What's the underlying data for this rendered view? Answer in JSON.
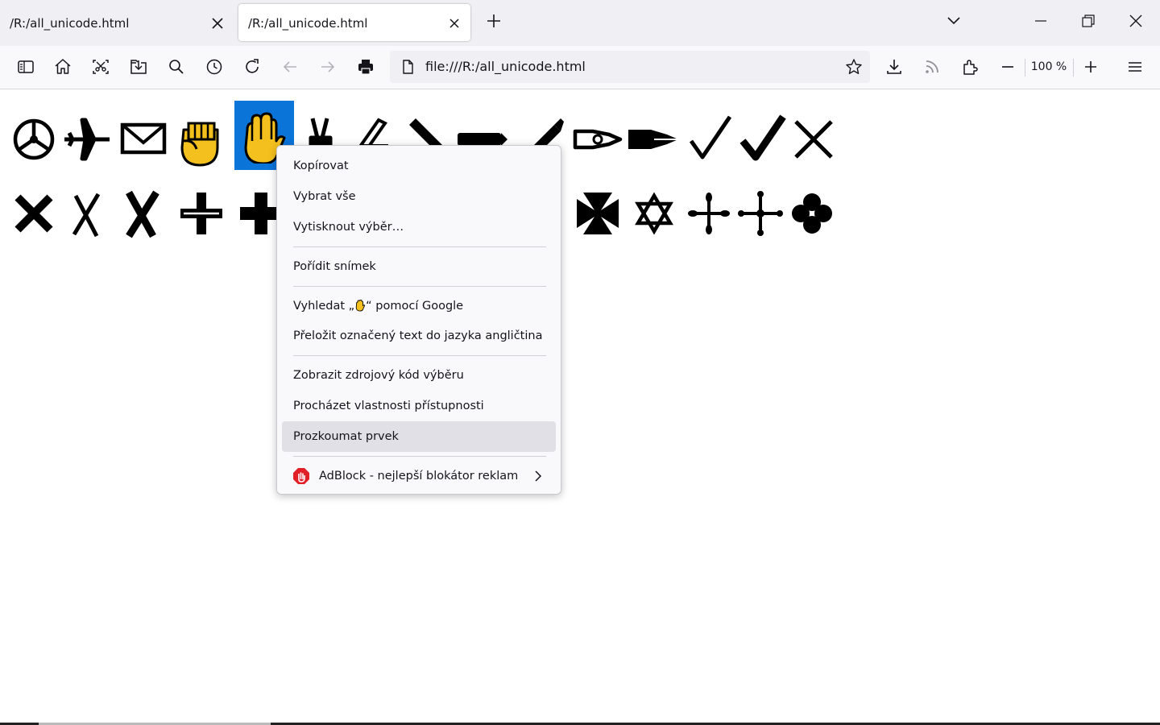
{
  "tabs": [
    {
      "title": "/R:/all_unicode.html",
      "active": false
    },
    {
      "title": "/R:/all_unicode.html",
      "active": true
    }
  ],
  "tabstrip": {
    "new_tab_icon": "plus-icon",
    "list_all_tabs_icon": "chevron-down-icon"
  },
  "window_controls": {
    "minimize_icon": "minimize-icon",
    "restore_icon": "restore-icon",
    "close_icon": "close-icon"
  },
  "toolbar": {
    "url": "file:///R:/all_unicode.html",
    "zoom_level": "100 %",
    "icons": [
      "sidebar-icon",
      "home-icon",
      "screenshot-icon",
      "save-page-icon",
      "search-icon",
      "history-icon",
      "reload-icon",
      "back-icon",
      "forward-icon",
      "print-icon",
      "bookmark-star-icon",
      "downloads-icon",
      "rss-icon",
      "extensions-icon",
      "zoom-out-icon",
      "zoom-in-icon",
      "menu-icon"
    ]
  },
  "page": {
    "row1_glyphs": [
      "steering-wheel",
      "airplane",
      "envelope",
      "raised-fist",
      "raised-hand",
      "victory-hand",
      "writing-hand",
      "pencil-lower-right",
      "pencil",
      "pencil-upper-right",
      "white-nib",
      "nib",
      "check-mark",
      "heavy-check-mark",
      "multiplication-x"
    ],
    "row2_glyphs": [
      "heavy-multiplication-x",
      "ballot-x",
      "heavy-ballot-x",
      "outlined-greek-cross",
      "heavy-greek-cross",
      "maltese-cross",
      "star-of-david",
      "six-teardrop-asterisk",
      "four-ball-asterisk",
      "four-club-asterisk"
    ],
    "selected_glyph": "raised-hand"
  },
  "context_menu": {
    "items": [
      {
        "label": "Kopírovat"
      },
      {
        "label": "Vybrat vše"
      },
      {
        "label": "Vytisknout výběr…"
      },
      {
        "label": "Pořídit snímek"
      },
      {
        "label_before": "Vyhledat „",
        "label_after": "“ pomocí Google"
      },
      {
        "label": "Přeložit označený text do jazyka angličtina"
      },
      {
        "label": "Zobrazit zdrojový kód výběru"
      },
      {
        "label": "Procházet vlastnosti přístupnosti"
      },
      {
        "label": "Prozkoumat prvek",
        "highlighted": true
      },
      {
        "label": "AdBlock - nejlepší blokátor reklam",
        "has_submenu": true
      }
    ]
  },
  "colors": {
    "selection": "#0a74d9",
    "emoji_yellow": "#f4c01e",
    "adblock_red": "#e01f26",
    "menu_hover": "#e0e0e6"
  }
}
